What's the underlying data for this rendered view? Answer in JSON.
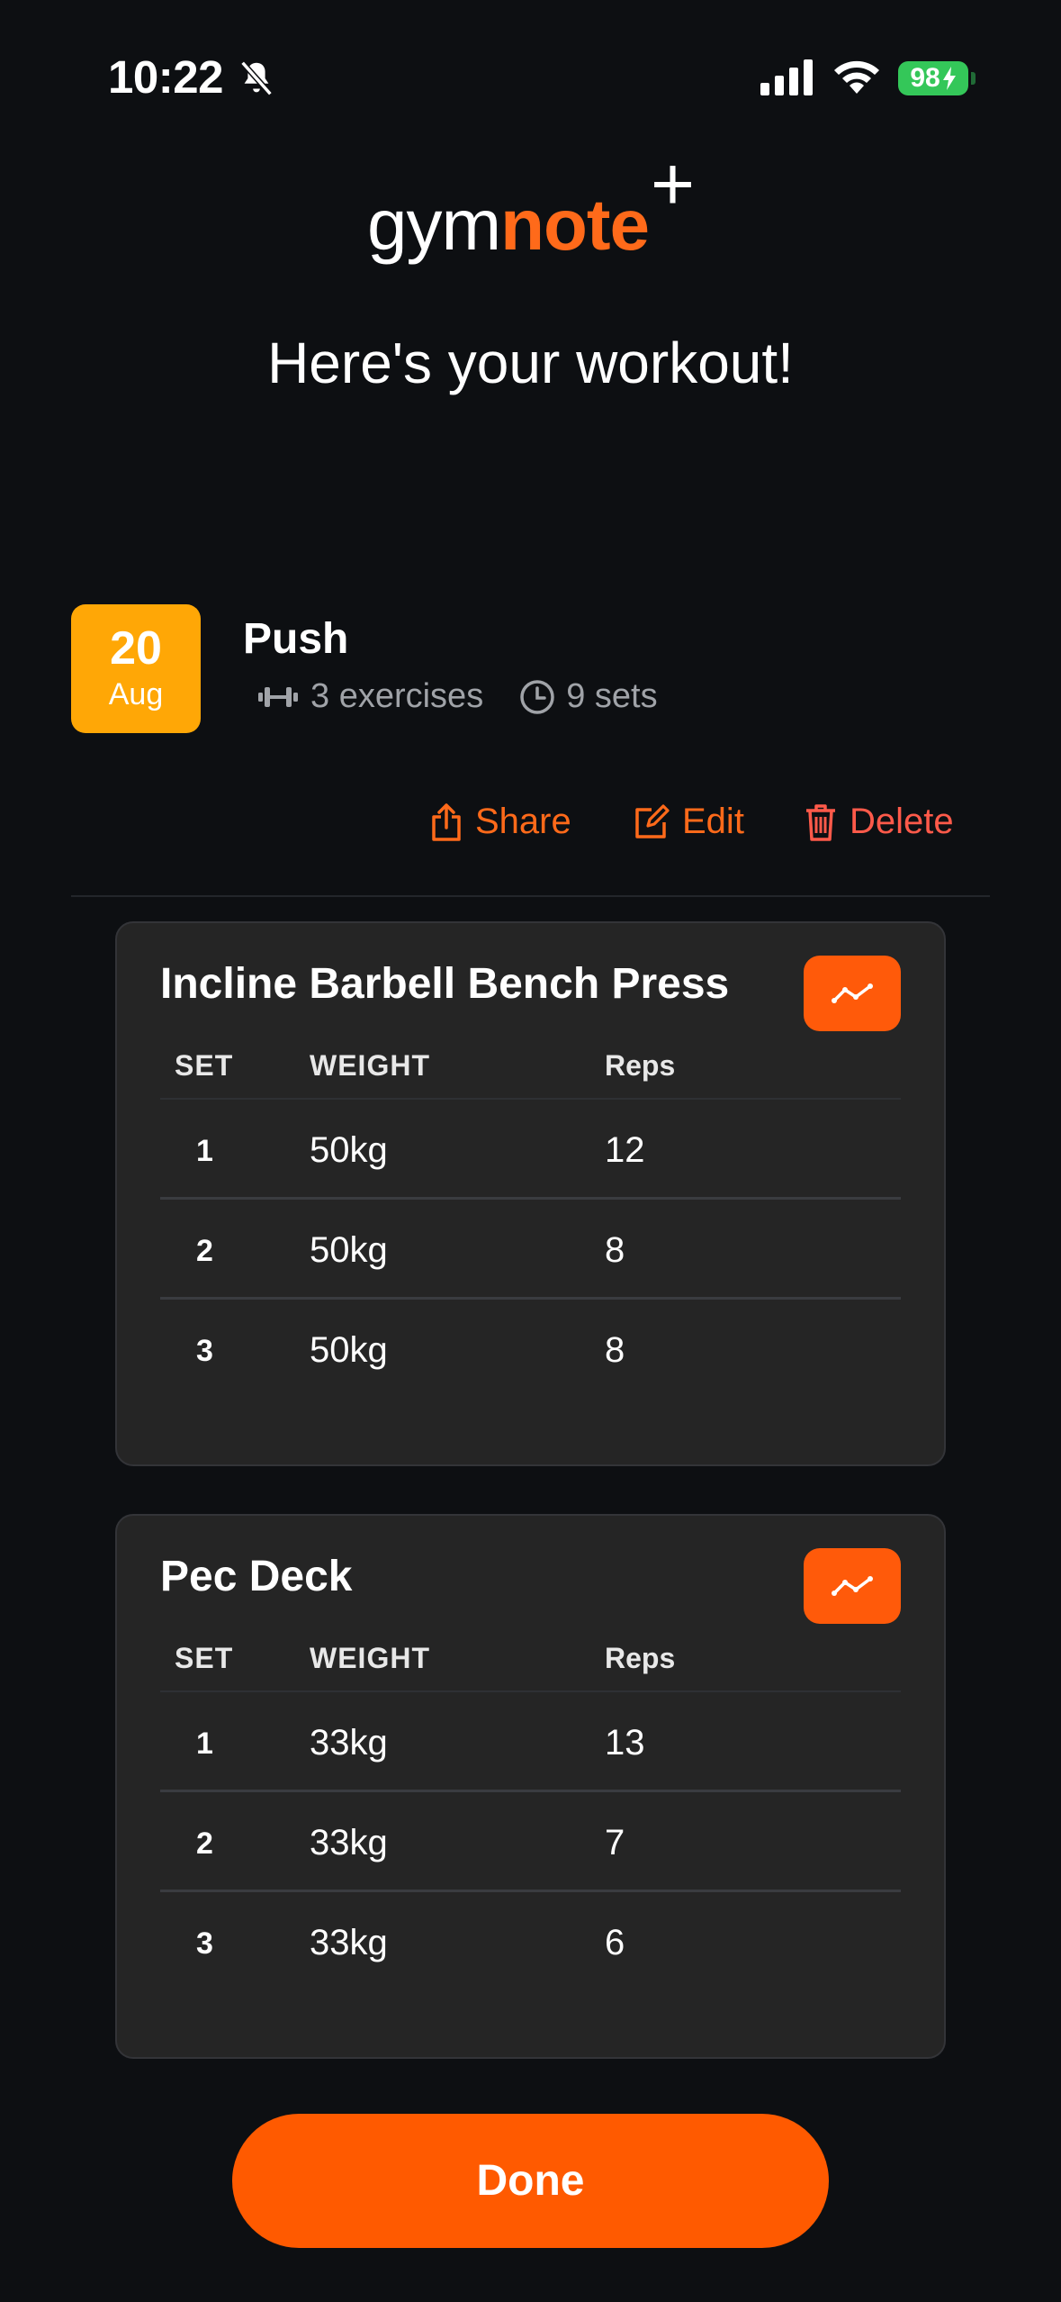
{
  "status_bar": {
    "time": "10:22",
    "battery": "98"
  },
  "logo": {
    "part1": "gym",
    "part2": "note",
    "part3": "+"
  },
  "headline": "Here's your workout!",
  "workout": {
    "day": "20",
    "month": "Aug",
    "name": "Push",
    "exercises_text": "3 exercises",
    "sets_text": "9 sets"
  },
  "actions": {
    "share": "Share",
    "edit": "Edit",
    "delete": "Delete"
  },
  "table_headers": {
    "set": "SET",
    "weight": "WEIGHT",
    "reps": "Reps"
  },
  "exercises": [
    {
      "name": "Incline Barbell Bench Press",
      "sets": [
        {
          "set": "1",
          "weight": "50kg",
          "reps": "12"
        },
        {
          "set": "2",
          "weight": "50kg",
          "reps": "8"
        },
        {
          "set": "3",
          "weight": "50kg",
          "reps": "8"
        }
      ]
    },
    {
      "name": "Pec Deck",
      "sets": [
        {
          "set": "1",
          "weight": "33kg",
          "reps": "13"
        },
        {
          "set": "2",
          "weight": "33kg",
          "reps": "7"
        },
        {
          "set": "3",
          "weight": "33kg",
          "reps": "6"
        }
      ]
    }
  ],
  "done_button": "Done",
  "colors": {
    "accent": "#ff5a00",
    "date_badge": "#ffa706",
    "delete": "#ff5a4a"
  }
}
